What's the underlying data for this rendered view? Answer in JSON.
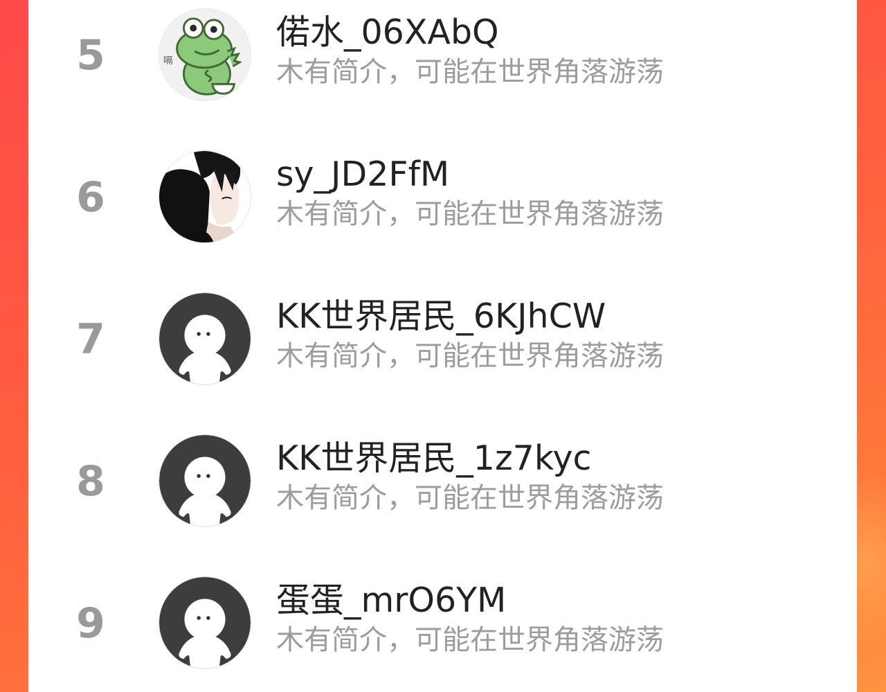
{
  "colors": {
    "background_start": "#ff4a4a",
    "background_end": "#ff9440",
    "card": "#ffffff",
    "rank_text": "#9a9a9a",
    "name_text": "#222222",
    "bio_text": "#9c9c9c"
  },
  "rankings": [
    {
      "rank": "5",
      "name": "偌水_06XAbQ",
      "bio": "木有简介，可能在世界角落游荡",
      "avatar": "frog-avatar"
    },
    {
      "rank": "6",
      "name": "sy_JD2FfM",
      "bio": "木有简介，可能在世界角落游荡",
      "avatar": "anime-boy-avatar"
    },
    {
      "rank": "7",
      "name": "KK世界居民_6KJhCW",
      "bio": "木有简介，可能在世界角落游荡",
      "avatar": "default-avatar"
    },
    {
      "rank": "8",
      "name": "KK世界居民_1z7kyc",
      "bio": "木有简介，可能在世界角落游荡",
      "avatar": "default-avatar"
    },
    {
      "rank": "9",
      "name": "蛋蛋_mrO6YM",
      "bio": "木有简介，可能在世界角落游荡",
      "avatar": "default-avatar"
    }
  ],
  "frog_badge_text": "嗝"
}
